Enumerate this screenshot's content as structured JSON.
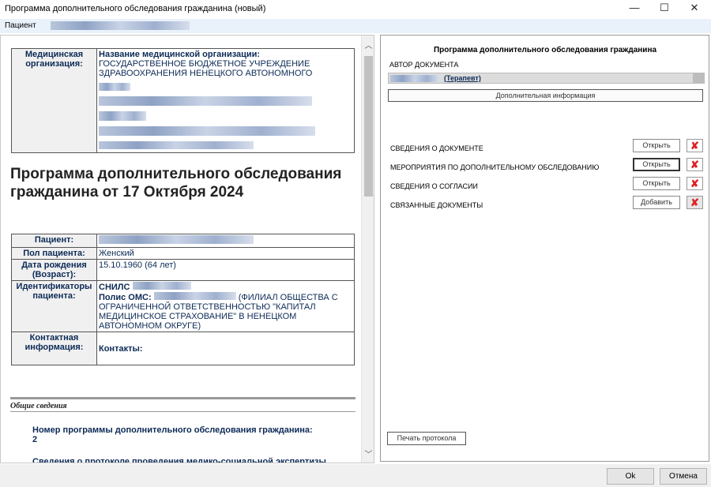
{
  "window": {
    "title": "Программа дополнительного обследования гражданина (новый)",
    "min_icon": "—",
    "max_icon": "☐",
    "close_icon": "✕"
  },
  "patient_bar": {
    "label": "Пациент"
  },
  "document": {
    "org_key": "Медицинская организация:",
    "org_name_label": "Название медицинской организации:",
    "org_name_text": "ГОСУДАРСТВЕННОЕ БЮДЖЕТНОЕ УЧРЕЖДЕНИЕ ЗДРАВООХРАНЕНИЯ НЕНЕЦКОГО АВТОНОМНОГО",
    "title": "Программа дополнительного обследования гражданина от 17 Октября 2024",
    "patient_key": "Пациент:",
    "sex_key": "Пол пациента:",
    "sex_value": "Женский",
    "dob_key": "Дата рождения (Возраст):",
    "dob_value": "15.10.1960 (64 лет)",
    "ids_key": "Идентификаторы пациента:",
    "snils_label": "СНИЛС",
    "oms_label": "Полис ОМС:",
    "oms_text": "(ФИЛИАЛ ОБЩЕСТВА С ОГРАНИЧЕННОЙ ОТВЕТСТВЕННОСТЬЮ \"КАПИТАЛ МЕДИЦИНСКОЕ СТРАХОВАНИЕ\" В НЕНЕЦКОМ АВТОНОМНОМ ОКРУГЕ)",
    "contact_key": "Контактная информация:",
    "contact_value": "Контакты:",
    "general_title": "Общие сведения",
    "program_number_label": "Номер программы дополнительного обследования гражданина:",
    "program_number_value": "2",
    "mse_protocol_label": "Сведения о протоколе проведения медико-социальной экспертизы"
  },
  "scroll": {
    "up_icon": "︿",
    "down_icon": "﹀"
  },
  "right_panel": {
    "title": "Программа дополнительного обследования гражданина",
    "author_label": "АВТОР ДОКУМЕНТА",
    "author_role": "(Терапевт)",
    "additional_info_button": "Дополнительная информация",
    "sections": [
      {
        "label": "СВЕДЕНИЯ О ДОКУМЕНТЕ",
        "button": "Открыть"
      },
      {
        "label": "МЕРОПРИЯТИЯ ПО ДОПОЛНИТЕЛЬНОМУ ОБСЛЕДОВАНИЮ",
        "button": "Открыть"
      },
      {
        "label": "СВЕДЕНИЯ О СОГЛАСИИ",
        "button": "Открыть"
      },
      {
        "label": "СВЯЗАННЫЕ ДОКУМЕНТЫ",
        "button": "Добавить"
      }
    ],
    "delete_icon": "✘",
    "print_button": "Печать протокола"
  },
  "footer": {
    "ok_button": "Ok",
    "cancel_button": "Отмена"
  }
}
